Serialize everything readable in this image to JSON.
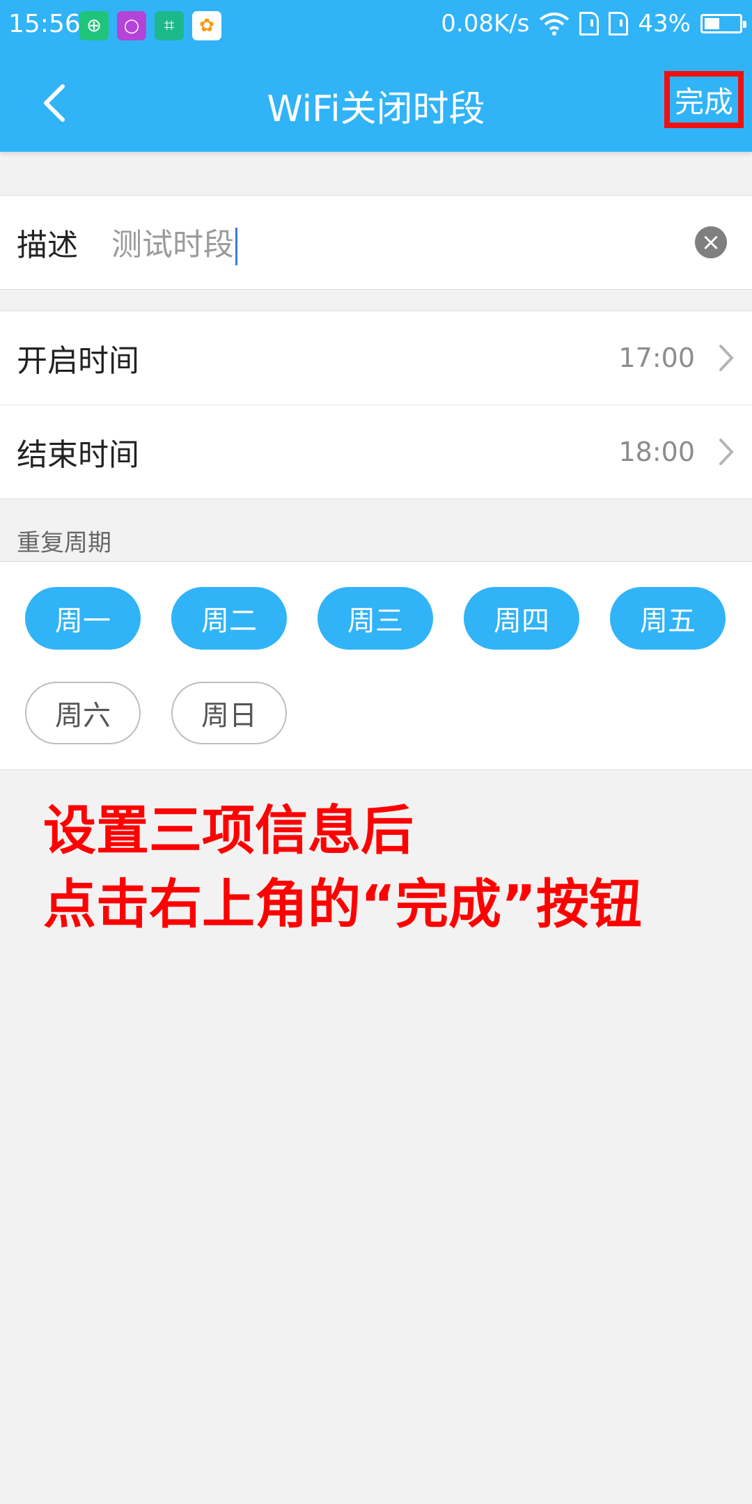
{
  "status_bar": {
    "time": "15:56",
    "net_speed": "0.08K/s",
    "battery": "43%",
    "battery_level": 0.43,
    "app_icons": [
      {
        "name": "plus-icon",
        "glyph": "⊕",
        "color": "#1fc47a"
      },
      {
        "name": "circle-icon",
        "glyph": "○",
        "color": "#b443d8"
      },
      {
        "name": "scan-icon",
        "glyph": "⌗",
        "color": "#1cb88c"
      },
      {
        "name": "pinwheel-icon",
        "glyph": "✿",
        "color": "#ffffff"
      }
    ]
  },
  "header": {
    "title": "WiFi关闭时段",
    "done_label": "完成",
    "accent": "#31b3f7"
  },
  "description": {
    "label": "描述",
    "value": "测试时段"
  },
  "times": {
    "start_label": "开启时间",
    "start_value": "17:00",
    "end_label": "结束时间",
    "end_value": "18:00"
  },
  "repeat": {
    "label": "重复周期",
    "days": [
      {
        "label": "周一",
        "selected": true
      },
      {
        "label": "周二",
        "selected": true
      },
      {
        "label": "周三",
        "selected": true
      },
      {
        "label": "周四",
        "selected": true
      },
      {
        "label": "周五",
        "selected": true
      },
      {
        "label": "周六",
        "selected": false
      },
      {
        "label": "周日",
        "selected": false
      }
    ]
  },
  "annotation": {
    "line1": "设置三项信息后",
    "line2": "点击右上角的“完成”按钮",
    "color": "#ff0000"
  }
}
